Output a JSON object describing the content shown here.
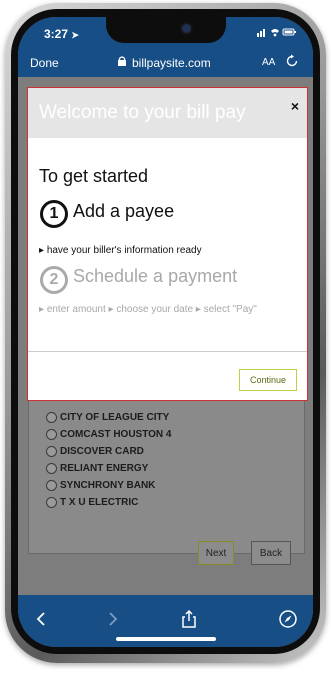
{
  "status_bar": {
    "time": "3:27",
    "right_icons": "signal wifi battery"
  },
  "browser": {
    "done_label": "Done",
    "host": "billpaysite.com",
    "text_size_label": "AA"
  },
  "modal": {
    "title": "Welcome to your bill pay",
    "close_label": "×",
    "heading": "To get started",
    "step1_number": "1",
    "step1_title": "Add a payee",
    "step1_note": "have your biller's information ready",
    "step2_number": "2",
    "step2_title": "Schedule a payment",
    "step2_note": "enter amount ▸ choose your date ▸ select \"Pay\"",
    "continue_label": "Continue"
  },
  "payees": [
    "CITY OF LEAGUE CITY",
    "COMCAST HOUSTON 4",
    "DISCOVER CARD",
    "RELIANT ENERGY",
    "SYNCHRONY BANK",
    "T X U ELECTRIC"
  ],
  "buttons": {
    "next_label": "Next",
    "back_label": "Back"
  },
  "colors": {
    "browser_chrome": "#174e86",
    "modal_border": "#cc3333",
    "continue_border": "#b9cf44"
  },
  "icons": [
    "location-arrow-icon",
    "lock-icon",
    "reload-icon",
    "back-icon",
    "forward-icon",
    "share-icon",
    "compass-icon"
  ]
}
